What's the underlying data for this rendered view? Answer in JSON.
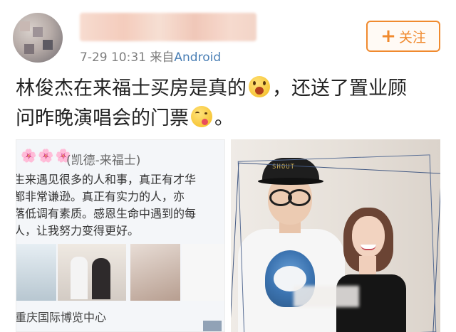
{
  "post": {
    "meta": {
      "time": "7-29 10:31",
      "from_prefix": "来自",
      "source": "Android"
    },
    "follow": {
      "plus": "+",
      "label": "关注"
    },
    "text_line1": "林俊杰在来福士买房是真的",
    "text_line1_tail": "，还送了置业顾",
    "text_line2": "问昨晚演唱会的门票",
    "text_line2_tail": "。",
    "emoji": [
      "surprised-face",
      "tongue-face"
    ]
  },
  "left_image": {
    "flowers": "🌸🌸🌸",
    "tag": "(凯德-来福士)",
    "lines": [
      "生来遇见很多的人和事，真正有才华",
      "都非常谦逊。真正有实力的人，亦",
      "落低调有素质。感恩生命中遇到的每",
      "人，让我努力变得更好。"
    ],
    "venue": "重庆国际博览中心"
  },
  "right_image": {
    "cap_text": "SHOUT"
  },
  "colors": {
    "accent": "#f08a2e",
    "link": "#4a7fb5",
    "meta": "#7e7e7e"
  }
}
